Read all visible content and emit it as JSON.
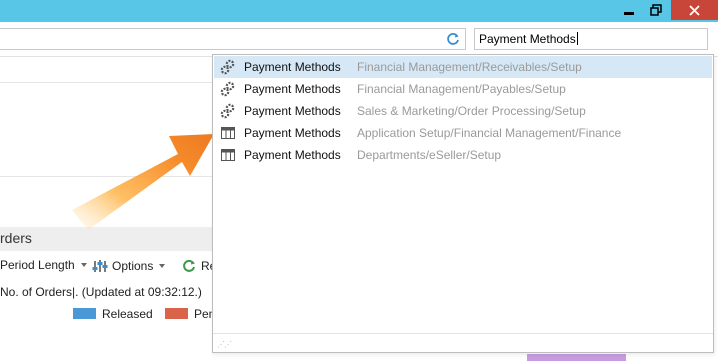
{
  "window": {
    "controls": {
      "minimize_icon": "minimize-icon",
      "restore_icon": "restore-icon",
      "close_icon": "close-icon"
    },
    "titlebar_color": "#58c6e6",
    "close_color": "#c8453a"
  },
  "toolbar": {
    "address_value": "",
    "refresh_icon": "refresh-icon"
  },
  "search": {
    "value": "Payment Methods"
  },
  "page": {
    "section_title": "rders",
    "toolbar": {
      "period_label": "Period Length",
      "options_label": "Options",
      "refresh_label": "Re"
    },
    "status_text": "No. of Orders|. (Updated at 09:32:12.)",
    "legend": [
      {
        "label": "Released",
        "color": "#4a98d6"
      },
      {
        "label": "Pen",
        "color": "#d9644a"
      }
    ]
  },
  "suggestions": [
    {
      "name": "Payment Methods",
      "path": "Financial Management/Receivables/Setup",
      "icon": "gears-icon",
      "selected": true
    },
    {
      "name": "Payment Methods",
      "path": "Financial Management/Payables/Setup",
      "icon": "gears-icon",
      "selected": false
    },
    {
      "name": "Payment Methods",
      "path": "Sales & Marketing/Order Processing/Setup",
      "icon": "gears-icon",
      "selected": false
    },
    {
      "name": "Payment Methods",
      "path": "Application Setup/Financial Management/Finance",
      "icon": "table-icon",
      "selected": false
    },
    {
      "name": "Payment Methods",
      "path": "Departments/eSeller/Setup",
      "icon": "table-icon",
      "selected": false
    }
  ]
}
